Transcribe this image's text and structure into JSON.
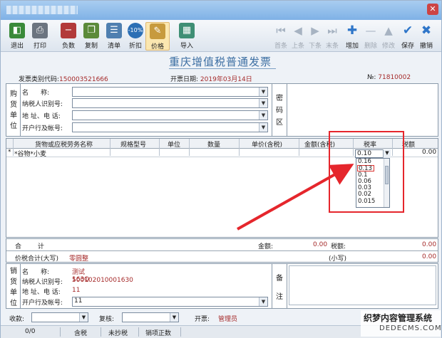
{
  "window": {
    "close_glyph": "✕"
  },
  "toolbar": {
    "items": [
      {
        "label": "退出",
        "icon": "exit-icon",
        "glyph": "◧"
      },
      {
        "label": "打印",
        "icon": "printer-icon",
        "glyph": "⎙"
      },
      {
        "label": "负数",
        "icon": "negative-icon",
        "glyph": "−"
      },
      {
        "label": "复制",
        "icon": "copy-icon",
        "glyph": "❐"
      },
      {
        "label": "清单",
        "icon": "list-icon",
        "glyph": "☰"
      },
      {
        "label": "折扣",
        "icon": "discount-icon",
        "glyph": "-10%"
      },
      {
        "label": "价格",
        "icon": "price-icon",
        "glyph": "✎"
      },
      {
        "label": "导入",
        "icon": "import-icon",
        "glyph": "▦"
      },
      {
        "label": "首条",
        "icon": "first-record-icon",
        "glyph": "⏮"
      },
      {
        "label": "上条",
        "icon": "previous-record-icon",
        "glyph": "◀"
      },
      {
        "label": "下条",
        "icon": "next-record-icon",
        "glyph": "▶"
      },
      {
        "label": "末条",
        "icon": "last-record-icon",
        "glyph": "⏭"
      },
      {
        "label": "增加",
        "icon": "add-icon",
        "glyph": "✚"
      },
      {
        "label": "删除",
        "icon": "delete-icon",
        "glyph": "—"
      },
      {
        "label": "修改",
        "icon": "edit-icon",
        "glyph": "▲"
      },
      {
        "label": "保存",
        "icon": "save-check-icon",
        "glyph": "✔"
      },
      {
        "label": "撤销",
        "icon": "undo-icon",
        "glyph": "✖"
      }
    ]
  },
  "invoice": {
    "title": "重庆增值税普通发票",
    "type_code_label": "发票类别代码:",
    "type_code_value": "150003521666",
    "date_label": "开票日期:",
    "date_value": "2019年03月14日",
    "no_label": "№:",
    "no_value": "71810002"
  },
  "buyer": {
    "side_label": [
      "购",
      "货",
      "单",
      "位"
    ],
    "fields": [
      {
        "label": "名      称:",
        "value": ""
      },
      {
        "label": "纳税人识别号:",
        "value": ""
      },
      {
        "label": "地 址、电 话:",
        "value": ""
      },
      {
        "label": "开户行及帐号:",
        "value": ""
      }
    ],
    "password_area": [
      "密",
      "码",
      "区"
    ]
  },
  "grid": {
    "columns": [
      "货物或应税劳务名称",
      "规格型号",
      "单位",
      "数量",
      "单价(含税)",
      "金额(含税)",
      "税率",
      "税额"
    ],
    "rows": [
      {
        "marker": "*",
        "name": "*谷物*小麦",
        "spec": "",
        "unit": "",
        "qty": "",
        "price": "",
        "amount": "",
        "rate": "0.10",
        "tax": "0.00"
      }
    ],
    "rate_options": [
      "0.16",
      "0.13",
      "0.1",
      "0.06",
      "0.03",
      "0.02",
      "0.015"
    ]
  },
  "totals": {
    "sum_label": "合        计",
    "amount_label": "金额:",
    "amount_value": "0.00",
    "tax_label": "税额:",
    "tax_value": "0.00",
    "grand_label": "价税合计(大写)",
    "grand_value": "零圆整",
    "small_label": "(小写)",
    "small_value": "0.00"
  },
  "seller": {
    "side_label": [
      "销",
      "货",
      "单",
      "位"
    ],
    "fields": [
      {
        "label": "名      称:",
        "value": "测试163Q"
      },
      {
        "label": "纳税人识别号:",
        "value": "500102010001630"
      },
      {
        "label": "地 址、电 话:",
        "value": "11"
      },
      {
        "label": "开户行及帐号:",
        "value": "11"
      }
    ],
    "remark_label": [
      "备",
      "注"
    ]
  },
  "bottom": {
    "payee_label": "收款:",
    "reviewer_label": "复核:",
    "issuer_label": "开票:",
    "issuer_value": "管理员"
  },
  "status": {
    "count": "0/0",
    "tax_incl": "含税",
    "not_copied": "未抄税",
    "doc_type": "销项正数"
  },
  "watermark": {
    "line1": "织梦内容管理系统",
    "line2": "DEDECMS.COM"
  }
}
